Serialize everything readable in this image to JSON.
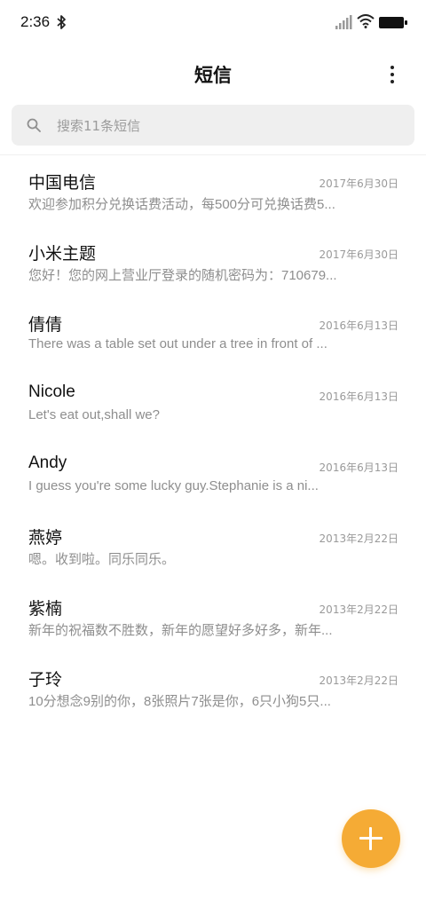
{
  "status_bar": {
    "time": "2:36",
    "icons": [
      "bluetooth-icon",
      "signal-icon",
      "wifi-icon",
      "battery-icon"
    ]
  },
  "header": {
    "title": "短信",
    "more_icon": "more-vertical-icon"
  },
  "search": {
    "placeholder": "搜索11条短信",
    "icon": "search-icon"
  },
  "conversations": [
    {
      "name": "中国电信",
      "date": "2017年6月30日",
      "preview": "欢迎参加积分兑换话费活动，每500分可兑换话费5..."
    },
    {
      "name": "小米主题",
      "date": "2017年6月30日",
      "preview": "您好！您的网上营业厅登录的随机密码为：710679..."
    },
    {
      "name": "倩倩",
      "date": "2016年6月13日",
      "preview": "There was a table set out under a tree in front of ..."
    },
    {
      "name": "Nicole",
      "date": "2016年6月13日",
      "preview": "Let's eat out,shall we?"
    },
    {
      "name": "Andy",
      "date": "2016年6月13日",
      "preview": "I guess you're some lucky guy.Stephanie is a ni..."
    },
    {
      "name": "燕婷",
      "date": "2013年2月22日",
      "preview": "嗯。收到啦。同乐同乐。"
    },
    {
      "name": "紫楠",
      "date": "2013年2月22日",
      "preview": "新年的祝福数不胜数，新年的愿望好多好多，新年..."
    },
    {
      "name": "子玲",
      "date": "2013年2月22日",
      "preview": "10分想念9别的你，8张照片7张是你，6只小狗5只..."
    }
  ],
  "fab": {
    "icon": "plus-icon"
  },
  "colors": {
    "accent": "#f5ab35",
    "search_bg": "#efefef",
    "secondary_text": "#8e8e8e"
  }
}
